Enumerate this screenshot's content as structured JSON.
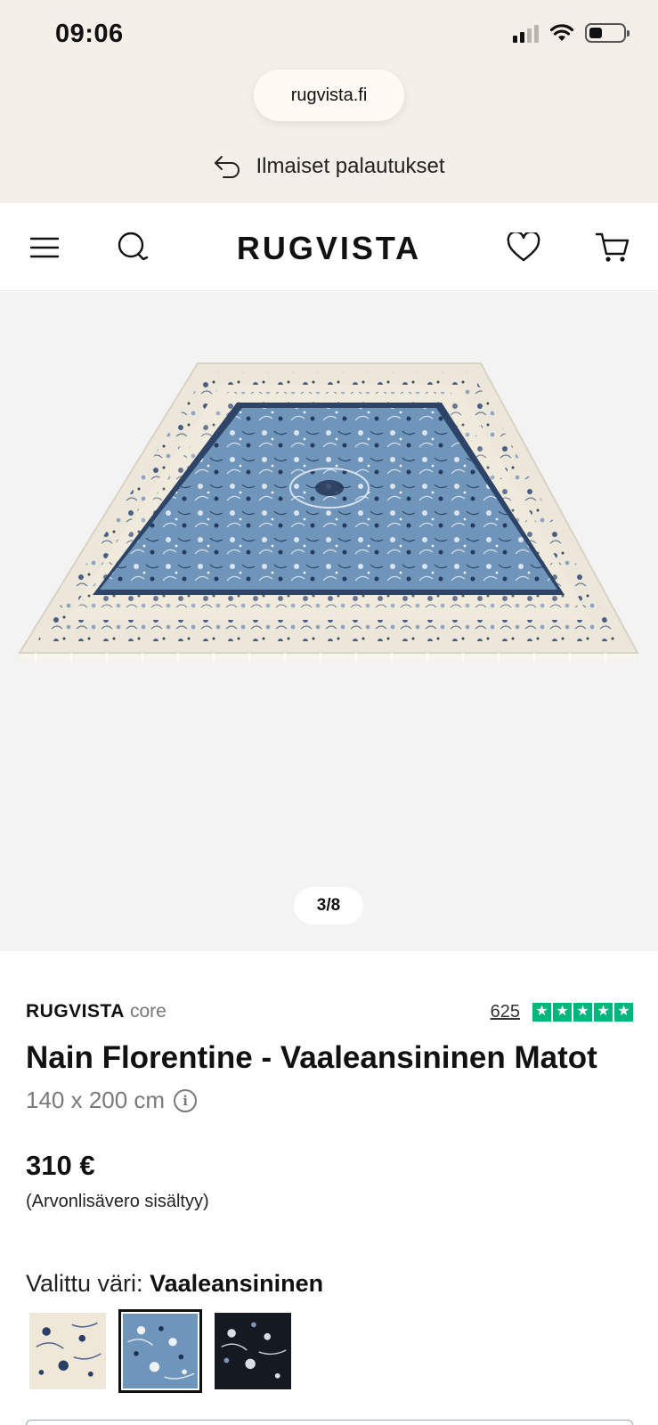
{
  "status_bar": {
    "time": "09:06"
  },
  "browser": {
    "url": "rugvista.fi"
  },
  "banner": {
    "returns_text": "Ilmaiset palautukset",
    "icon": "return-arrow-icon"
  },
  "header": {
    "logo": "RUGVISTA",
    "menu_icon": "hamburger-menu-icon",
    "search_icon": "search-icon",
    "wishlist_icon": "heart-icon",
    "cart_icon": "cart-icon"
  },
  "gallery": {
    "counter": "3/8"
  },
  "product": {
    "brand": "RUGVISTA",
    "brand_sub": "core",
    "review_count": "625",
    "star_count": 5,
    "title": "Nain Florentine - Vaaleansininen Matot",
    "size": "140 x 200 cm",
    "price": "310 €",
    "vat_note": "(Arvonlisävero sisältyy)",
    "color_label": "Valittu väri:",
    "color_value": "Vaaleansininen",
    "swatches": [
      {
        "name": "cream",
        "color": "#efe8d8",
        "selected": false
      },
      {
        "name": "light-blue",
        "color": "#6f95bb",
        "selected": true
      },
      {
        "name": "black",
        "color": "#151a22",
        "selected": false
      }
    ]
  },
  "colors": {
    "topbar_bg": "#f4efe9",
    "trustpilot_green": "#00b67a",
    "rug_blue": "#6f95bb",
    "rug_cream": "#efeadc"
  }
}
